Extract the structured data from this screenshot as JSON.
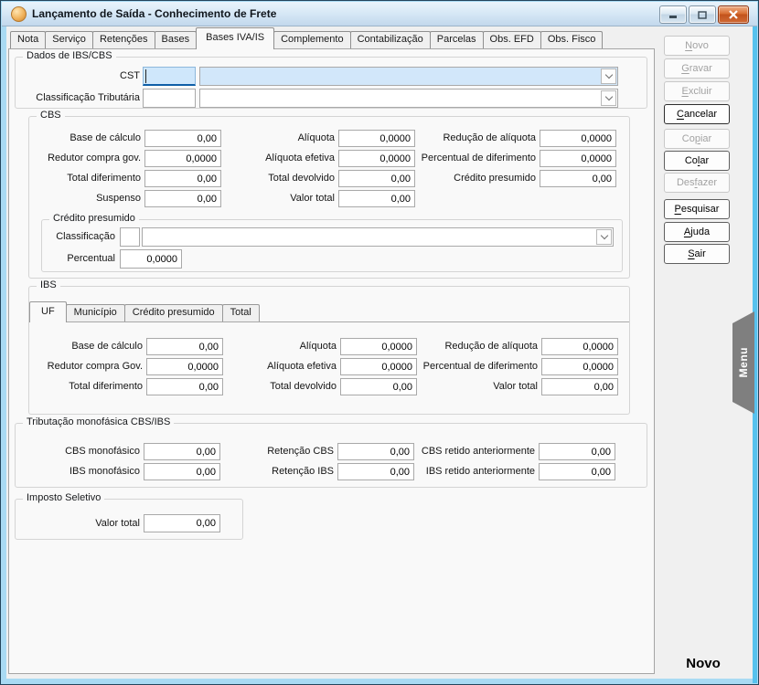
{
  "window": {
    "title": "Lançamento de Saída - Conhecimento de Frete",
    "status_label": "Novo"
  },
  "icons": {
    "app": "orange-disc",
    "minimize": "—",
    "maximize": "▢",
    "close": "✕",
    "dropdown": "chevron-down"
  },
  "colors": {
    "titlebar": "#d4e6f5",
    "frame": "#57c2ee",
    "close_button": "#c2531c",
    "focus_fill": "#cfe7fb",
    "focus_border": "#0f5fa8",
    "menu_tab": "#7f7f7f",
    "page_bg": "#f9f9f9",
    "dialog_bg": "#f0f0f0"
  },
  "tab_strip": {
    "active": "Bases IVA/IS",
    "tabs": [
      {
        "label": "Nota"
      },
      {
        "label": "Serviço"
      },
      {
        "label": "Retenções"
      },
      {
        "label": "Bases"
      },
      {
        "label": "Bases IVA/IS"
      },
      {
        "label": "Complemento"
      },
      {
        "label": "Contabilização"
      },
      {
        "label": "Parcelas"
      },
      {
        "label": "Obs. EFD"
      },
      {
        "label": "Obs. Fisco"
      }
    ]
  },
  "dados": {
    "title": "Dados de IBS/CBS",
    "cst": {
      "label": "CST",
      "code_value": "",
      "combo_value": ""
    },
    "classificacao": {
      "label": "Classificação Tributária",
      "code_value": "",
      "combo_value": ""
    }
  },
  "cbs": {
    "title": "CBS",
    "fields": [
      {
        "label": "Base de cálculo",
        "value": "0,00"
      },
      {
        "label": "Alíquota",
        "value": "0,0000"
      },
      {
        "label": "Redução de alíquota",
        "value": "0,0000"
      },
      {
        "label": "Redutor compra gov.",
        "value": "0,0000"
      },
      {
        "label": "Alíquota efetiva",
        "value": "0,0000"
      },
      {
        "label": "Percentual de diferimento",
        "value": "0,0000"
      },
      {
        "label": "Total diferimento",
        "value": "0,00"
      },
      {
        "label": "Total devolvido",
        "value": "0,00"
      },
      {
        "label": "Crédito presumido",
        "value": "0,00"
      },
      {
        "label": "Suspenso",
        "value": "0,00"
      },
      {
        "label": "Valor total",
        "value": "0,00"
      }
    ],
    "credito_presumido": {
      "title": "Crédito presumido",
      "classificacao_label": "Classificação",
      "classificacao_code": "",
      "classificacao_combo": "",
      "percentual_label": "Percentual",
      "percentual_value": "0,0000"
    }
  },
  "ibs": {
    "title": "IBS",
    "active_tab": "UF",
    "tabs": [
      {
        "label": "UF"
      },
      {
        "label": "Município"
      },
      {
        "label": "Crédito presumido"
      },
      {
        "label": "Total"
      }
    ],
    "fields": [
      {
        "label": "Base de cálculo",
        "value": "0,00"
      },
      {
        "label": "Alíquota",
        "value": "0,0000"
      },
      {
        "label": "Redução de alíquota",
        "value": "0,0000"
      },
      {
        "label": "Redutor compra Gov.",
        "value": "0,0000"
      },
      {
        "label": "Alíquota efetiva",
        "value": "0,0000"
      },
      {
        "label": "Percentual de diferimento",
        "value": "0,0000"
      },
      {
        "label": "Total diferimento",
        "value": "0,00"
      },
      {
        "label": "Total devolvido",
        "value": "0,00"
      },
      {
        "label": "Valor total",
        "value": "0,00"
      }
    ]
  },
  "monofasica": {
    "title": "Tributação monofásica CBS/IBS",
    "fields": [
      {
        "label": "CBS monofásico",
        "value": "0,00"
      },
      {
        "label": "Retenção CBS",
        "value": "0,00"
      },
      {
        "label": "CBS retido anteriormente",
        "value": "0,00"
      },
      {
        "label": "IBS monofásico",
        "value": "0,00"
      },
      {
        "label": "Retenção IBS",
        "value": "0,00"
      },
      {
        "label": "IBS retido anteriormente",
        "value": "0,00"
      }
    ]
  },
  "seletivo": {
    "title": "Imposto Seletivo",
    "fields": [
      {
        "label": "Valor total",
        "value": "0,00"
      }
    ]
  },
  "sidebar": {
    "buttons": [
      {
        "pre": "",
        "key": "N",
        "post": "ovo",
        "enabled": false
      },
      {
        "pre": "",
        "key": "G",
        "post": "ravar",
        "enabled": false
      },
      {
        "pre": "",
        "key": "E",
        "post": "xcluir",
        "enabled": false
      },
      {
        "pre": "",
        "key": "C",
        "post": "ancelar",
        "enabled": true
      },
      {
        "pre": "Co",
        "key": "p",
        "post": "iar",
        "enabled": false
      },
      {
        "pre": "Co",
        "key": "l",
        "post": "ar",
        "enabled": true
      },
      {
        "pre": "Des",
        "key": "f",
        "post": "azer",
        "enabled": false
      },
      {
        "pre": "",
        "key": "P",
        "post": "esquisar",
        "enabled": true
      },
      {
        "pre": "",
        "key": "A",
        "post": "juda",
        "enabled": true
      },
      {
        "pre": "",
        "key": "S",
        "post": "air",
        "enabled": true
      }
    ]
  },
  "menu_tab": {
    "label": "Menu"
  }
}
